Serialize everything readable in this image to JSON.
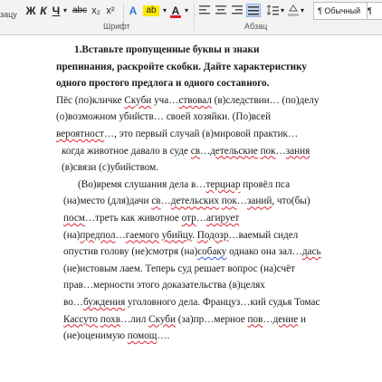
{
  "ribbon": {
    "left_label": "зацу",
    "font_group_label": "Шрифт",
    "para_group_label": "Абзац",
    "bold": "Ж",
    "italic": "К",
    "underline": "Ч",
    "strike": "abc",
    "subscript": "x₂",
    "superscript": "x²",
    "highlight": "ab",
    "font_color": "A",
    "style_normal": "¶ Обычный",
    "style_next": "¶ Бе"
  },
  "doc": {
    "heading": [
      "1.Вставьте пропущенные буквы и знаки",
      "препинания, раскройте скобки. Дайте характеристику",
      "одного простого предлога и одного составного."
    ],
    "p1": [
      [
        "Пёс (по)кличке ",
        {
          "w": "Скуби",
          "u": "red"
        },
        " уча…",
        {
          "w": "ствовал",
          "u": "red"
        },
        " (в)следствии… (по)делу"
      ],
      [
        "(о)возможном убийств… своей хозяйки. (По)всей"
      ],
      [
        {
          "w": "вероятност",
          "u": "red"
        },
        "…, это первый случай (в)мировой практик…"
      ],
      [
        "когда животное давало в суде ",
        {
          "w": "св",
          "u": "red"
        },
        "…",
        {
          "w": "детельские",
          "u": "red"
        },
        " ",
        {
          "w": "пок",
          "u": "red"
        },
        "…",
        {
          "w": "зания",
          "u": "red"
        }
      ],
      [
        "(в)связи (с)убийством."
      ]
    ],
    "p2": [
      [
        "(Во)время слушания дела в…",
        {
          "w": "терцнар",
          "u": "red"
        },
        " провёл пса"
      ],
      [
        "(на)место (для)дачи ",
        {
          "w": "св",
          "u": "red"
        },
        "…",
        {
          "w": "детельских",
          "u": "red"
        },
        " ",
        {
          "w": "пок",
          "u": "red"
        },
        "…",
        {
          "w": "заний",
          "u": "red"
        },
        ", что(бы)"
      ],
      [
        {
          "w": "посм",
          "u": "red"
        },
        "…треть как животное ",
        {
          "w": "отр",
          "u": "red"
        },
        "…",
        {
          "w": "агирует",
          "u": "red"
        }
      ],
      [
        "(на)",
        {
          "w": "предпол",
          "u": "red"
        },
        "…",
        {
          "w": "гаемого",
          "u": "red"
        },
        " ",
        {
          "w": "убийцу",
          "u": "red"
        },
        ". ",
        {
          "w": "Подозр",
          "u": "red"
        },
        "…ваемый сидел"
      ],
      [
        "опустив голову (не)смотря (на)",
        {
          "w": "собаку",
          "u": "blue"
        },
        " однако она зал…",
        {
          "w": "дась",
          "u": "red"
        }
      ],
      [
        "(не)истовым лаем. Теперь суд решает вопрос (на)счёт"
      ],
      [
        "прав…мерности этого доказательства (в)целях"
      ],
      [
        "во…",
        {
          "w": "буждения",
          "u": "red"
        },
        " уголовного дела. Француз…кий судья Томас"
      ],
      [
        {
          "w": "Кассуто",
          "u": "red"
        },
        " ",
        {
          "w": "похв",
          "u": "red"
        },
        "…лил ",
        {
          "w": "Скуби",
          "u": "red"
        },
        " (за)пр…мерное ",
        {
          "w": "пов",
          "u": "red"
        },
        "…",
        {
          "w": "дение",
          "u": "red"
        },
        " и"
      ],
      [
        "(не)оценимую ",
        {
          "w": "помощ",
          "u": "red"
        },
        "…."
      ]
    ]
  }
}
